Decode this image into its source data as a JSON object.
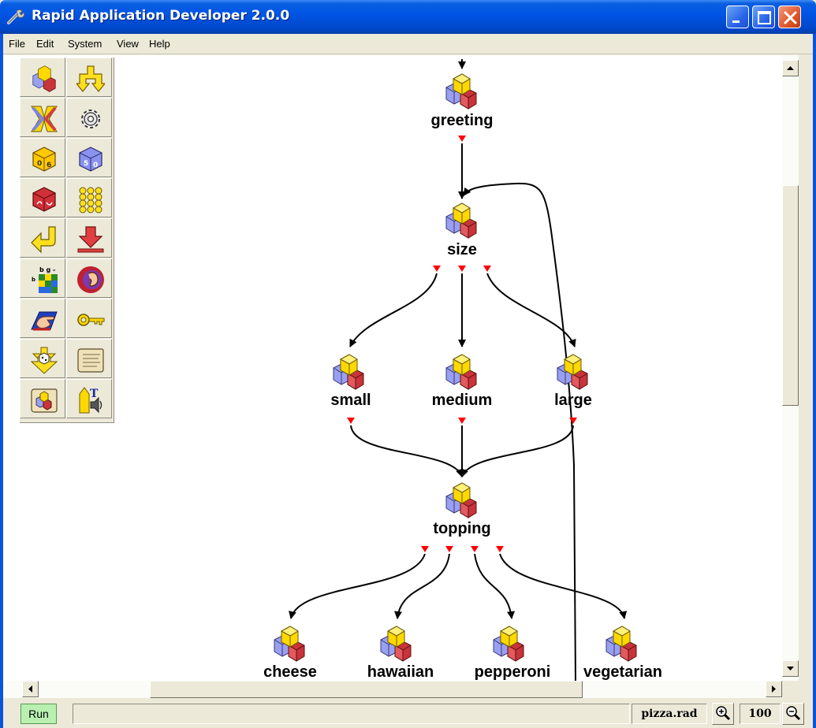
{
  "window": {
    "title": "Rapid Application Developer 2.0.0",
    "title_icon": "wrench-icon"
  },
  "menu": {
    "items": [
      "File",
      "Edit",
      "System",
      "View",
      "Help"
    ]
  },
  "palette": {
    "items": [
      {
        "icon": "blocks-object-icon"
      },
      {
        "icon": "yellow-fork-arrow-icon"
      },
      {
        "icon": "merge-arrows-icon"
      },
      {
        "icon": "gear-icon"
      },
      {
        "icon": "yellow-dice-icon"
      },
      {
        "icon": "blue-dice-icon"
      },
      {
        "icon": "red-dice-icon"
      },
      {
        "icon": "yellow-keypad-icon"
      },
      {
        "icon": "return-arrow-icon"
      },
      {
        "icon": "red-down-arrow-icon"
      },
      {
        "icon": "letter-grid-icon"
      },
      {
        "icon": "ear-icon"
      },
      {
        "icon": "hand-pointer-icon"
      },
      {
        "icon": "key-icon"
      },
      {
        "icon": "arrows-die-icon"
      },
      {
        "icon": "scroll-icon"
      },
      {
        "icon": "scroll-blocks-icon"
      },
      {
        "icon": "pencil-speaker-icon"
      }
    ]
  },
  "diagram": {
    "nodes": [
      {
        "id": "greeting",
        "label": "greeting"
      },
      {
        "id": "size",
        "label": "size"
      },
      {
        "id": "small",
        "label": "small"
      },
      {
        "id": "medium",
        "label": "medium"
      },
      {
        "id": "large",
        "label": "large"
      },
      {
        "id": "topping",
        "label": "topping"
      },
      {
        "id": "cheese",
        "label": "cheese"
      },
      {
        "id": "hawaiian",
        "label": "hawaiian"
      },
      {
        "id": "pepperoni",
        "label": "pepperoni"
      },
      {
        "id": "vegetarian",
        "label": "vegetarian"
      }
    ],
    "edges": [
      [
        "greeting",
        "size"
      ],
      [
        "size",
        "small"
      ],
      [
        "size",
        "medium"
      ],
      [
        "size",
        "large"
      ],
      [
        "small",
        "topping"
      ],
      [
        "medium",
        "topping"
      ],
      [
        "large",
        "topping"
      ],
      [
        "topping",
        "cheese"
      ],
      [
        "topping",
        "hawaiian"
      ],
      [
        "topping",
        "pepperoni"
      ],
      [
        "topping",
        "vegetarian"
      ],
      [
        "vegetarian",
        "size"
      ]
    ]
  },
  "status": {
    "run_label": "Run",
    "message": "",
    "filename": "pizza.rad",
    "zoom": "100",
    "zoom_in_icon": "zoom-in-icon",
    "zoom_out_icon": "zoom-out-icon"
  },
  "colors": {
    "titlebar": "#0055e5",
    "port": "#ff0000",
    "cube_yellow": "#ffd800",
    "cube_blue": "#8a8ee6",
    "cube_red": "#c8343a",
    "run_button": "#b9f0b1"
  }
}
